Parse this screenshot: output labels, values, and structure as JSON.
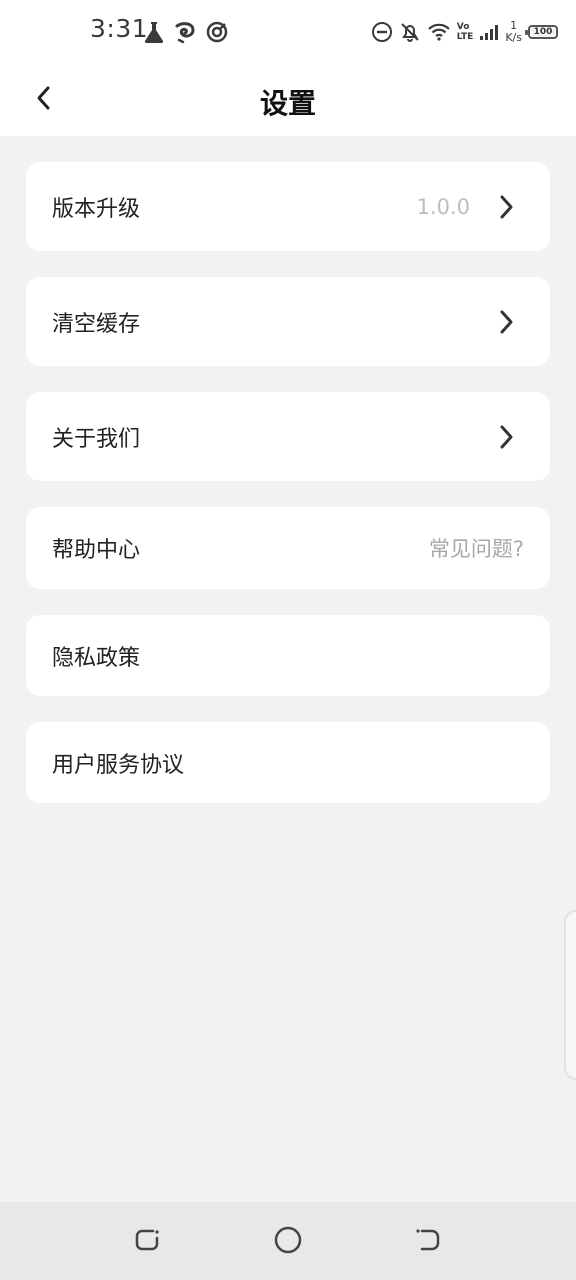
{
  "status_bar": {
    "time": "3:31",
    "net_speed_value": "1",
    "net_speed_unit": "K/s",
    "volte_top": "Vo",
    "volte_bottom": "LTE",
    "battery": "100",
    "icons": [
      "flask-icon",
      "swirl-icon",
      "circle-notification-icon",
      "do-not-disturb-icon",
      "bell-off-icon",
      "wifi-icon",
      "signal-icon"
    ]
  },
  "header": {
    "title": "设置",
    "back_icon": "chevron-left-icon"
  },
  "menu": {
    "version_upgrade": {
      "label": "版本升级",
      "value": "1.0.0"
    },
    "clear_cache": {
      "label": "清空缓存"
    },
    "about_us": {
      "label": "关于我们"
    },
    "help_center": {
      "label": "帮助中心",
      "value": "常见问题?"
    },
    "privacy_policy": {
      "label": "隐私政策"
    },
    "user_agreement": {
      "label": "用户服务协议"
    }
  },
  "nav_bar": {
    "icons": [
      "recent-apps-icon",
      "home-icon",
      "back-nav-icon"
    ]
  },
  "colors": {
    "background": "#f2f2f2",
    "card": "#ffffff",
    "value_text": "#bdbdbd",
    "nav_bar": "#e8e8e8"
  }
}
